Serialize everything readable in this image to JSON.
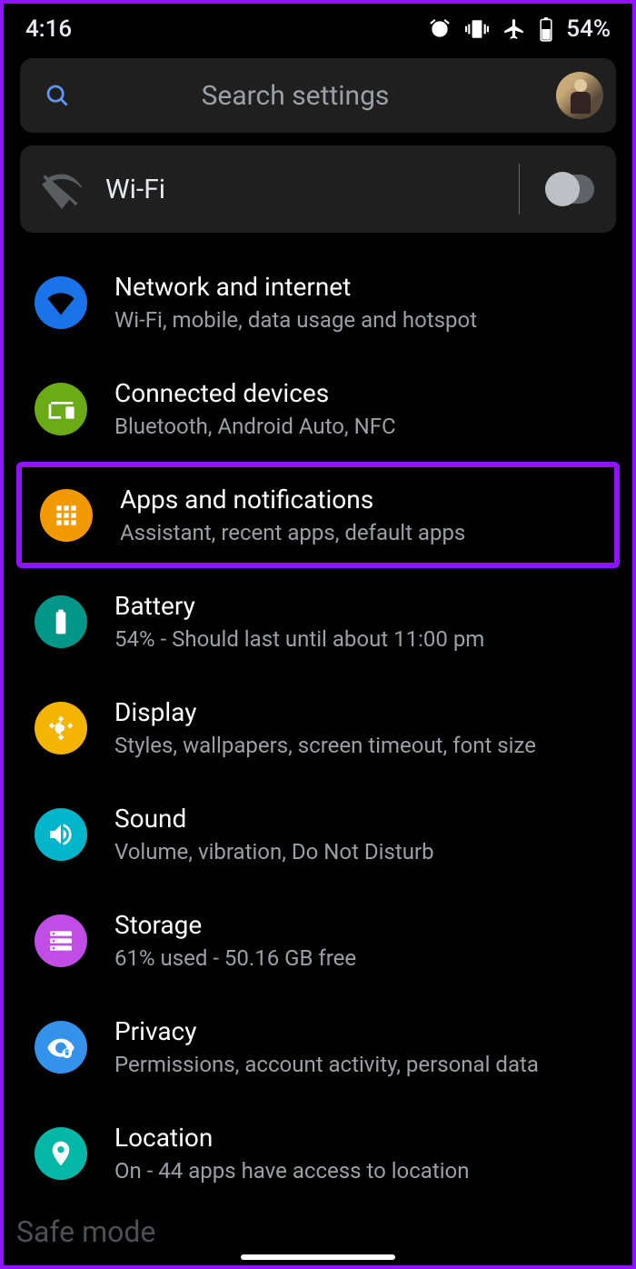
{
  "status": {
    "time": "4:16",
    "battery_text": "54%"
  },
  "search": {
    "placeholder": "Search settings"
  },
  "wifi_card": {
    "label": "Wi-Fi",
    "enabled": false
  },
  "safe_mode_label": "Safe mode",
  "colors": {
    "network": "#1a73e8",
    "devices": "#6aab16",
    "apps": "#f29900",
    "battery": "#009688",
    "display": "#f4b400",
    "sound": "#01b6cb",
    "storage": "#c14ce6",
    "privacy": "#3492eb",
    "location": "#03b8a6"
  },
  "rows": [
    {
      "key": "network",
      "title": "Network and internet",
      "sub": "Wi-Fi, mobile, data usage and hotspot"
    },
    {
      "key": "devices",
      "title": "Connected devices",
      "sub": "Bluetooth, Android Auto, NFC"
    },
    {
      "key": "apps",
      "title": "Apps and notifications",
      "sub": "Assistant, recent apps, default apps"
    },
    {
      "key": "battery",
      "title": "Battery",
      "sub": "54% - Should last until about 11:00 pm"
    },
    {
      "key": "display",
      "title": "Display",
      "sub": "Styles, wallpapers, screen timeout, font size"
    },
    {
      "key": "sound",
      "title": "Sound",
      "sub": "Volume, vibration, Do Not Disturb"
    },
    {
      "key": "storage",
      "title": "Storage",
      "sub": "61% used - 50.16 GB free"
    },
    {
      "key": "privacy",
      "title": "Privacy",
      "sub": "Permissions, account activity, personal data"
    },
    {
      "key": "location",
      "title": "Location",
      "sub": "On - 44 apps have access to location"
    }
  ]
}
